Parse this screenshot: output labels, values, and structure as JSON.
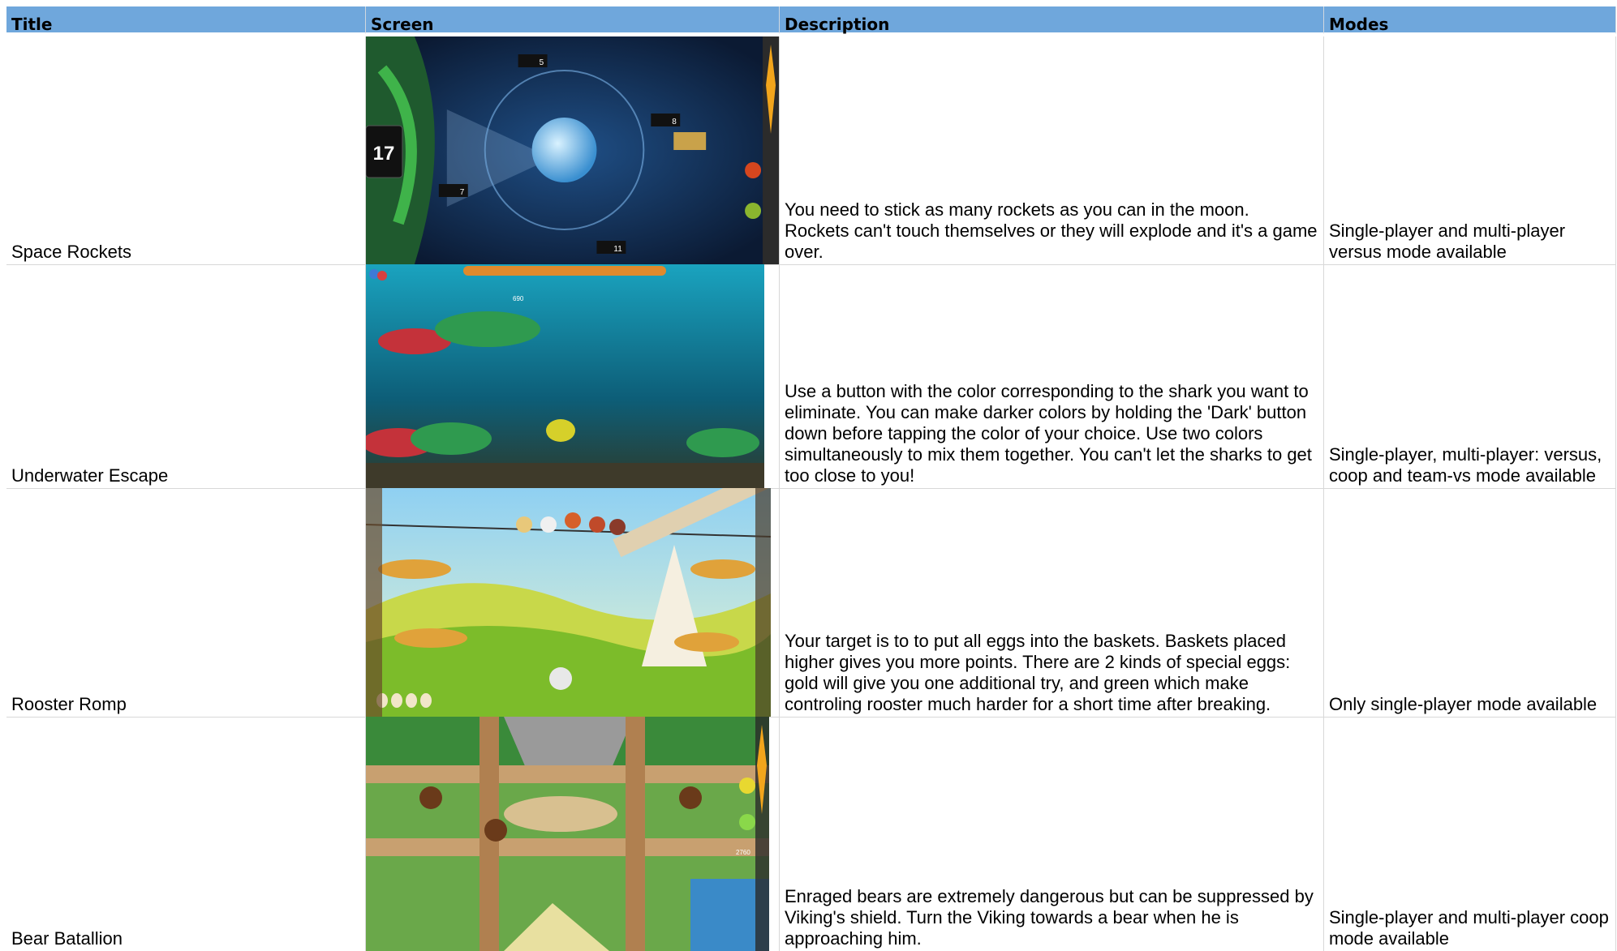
{
  "columns": [
    "Title",
    "Screen",
    "Description",
    "Modes"
  ],
  "rows": [
    {
      "title": "Space Rockets",
      "description": "You need to stick as many rockets as you can in the moon. Rockets can't touch themselves or they will explode and it's a game over.",
      "modes": "Single-player and multi-player versus mode available",
      "hud": {
        "counter": "17",
        "score_top": "5",
        "score_right": "8",
        "score_left": "7",
        "score_bottom": "11"
      }
    },
    {
      "title": "Underwater Escape",
      "description": "Use a button with the color corresponding to the shark you want to eliminate. You can make darker colors by holding the 'Dark' button down before tapping the color of your choice. Use two colors simultaneously to mix them together. You can't let the sharks to get too close to you!",
      "modes": "Single-player, multi-player: versus, coop and team-vs mode available",
      "hud": {
        "score": "690"
      }
    },
    {
      "title": "Rooster Romp",
      "description": "Your target is to to put all eggs into the baskets. Baskets placed higher gives you more points. There are 2 kinds of special eggs: gold will give you one additional try, and green which make controling rooster much harder for a short time after breaking.",
      "modes": "Only single-player mode available"
    },
    {
      "title": "Bear Batallion",
      "description": "Enraged bears are extremely dangerous but can be suppressed by Viking's shield. Turn the Viking towards a bear when he is approaching him.",
      "modes": "Single-player and multi-player coop mode available",
      "hud": {
        "score": "2760"
      }
    }
  ]
}
